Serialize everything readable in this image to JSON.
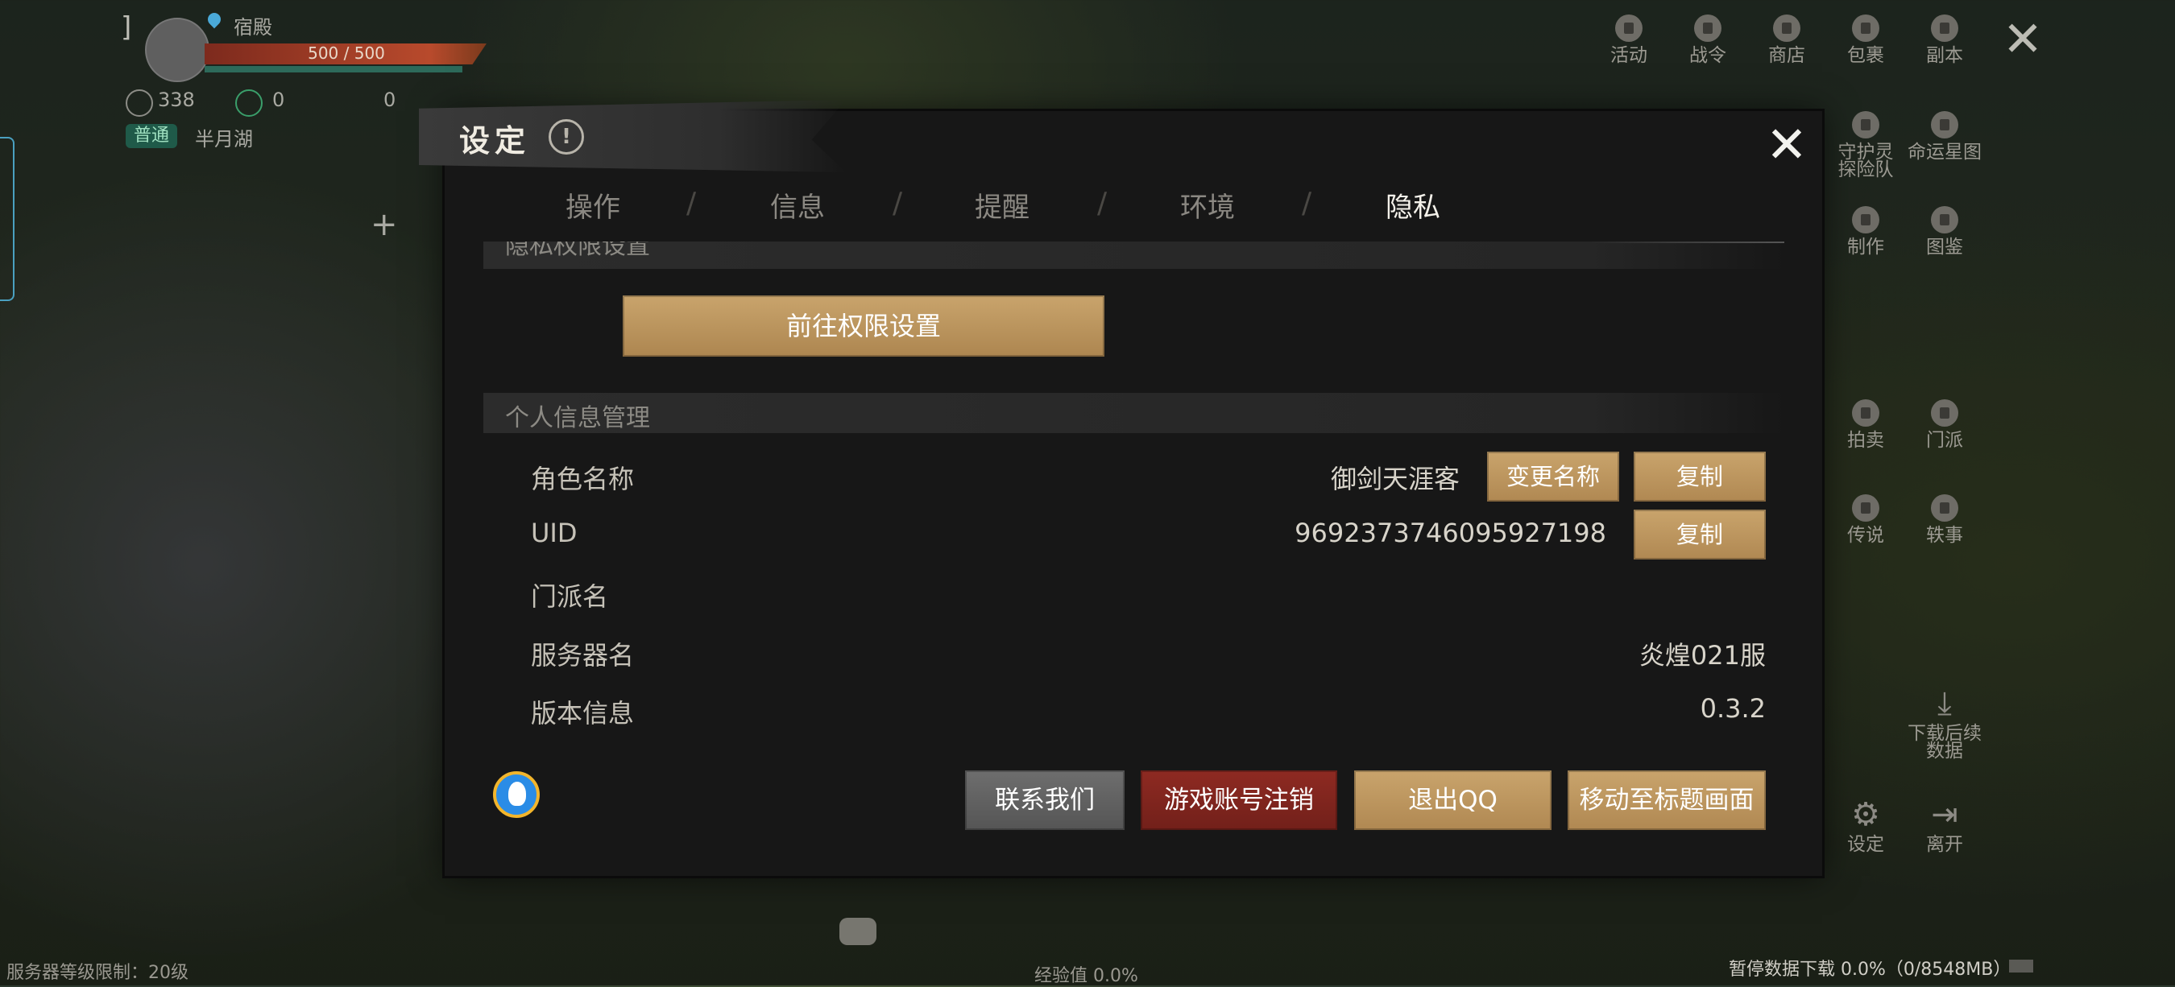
{
  "hud": {
    "location": "宿殿",
    "hp": "500 / 500",
    "currency1": "338",
    "currency2": "0",
    "currency3": "0",
    "status_badge": "普通",
    "area": "半月湖",
    "server_level_note": "服务器等级限制：20级",
    "exp_text": "经验值 0.0%",
    "download_status": "暂停数据下载 0.0%（0/8548MB）"
  },
  "right_menu": {
    "items": [
      {
        "label": "活动",
        "icon": "lock-icon"
      },
      {
        "label": "战令",
        "icon": "lock-icon"
      },
      {
        "label": "商店",
        "icon": "lock-icon"
      },
      {
        "label": "包裹",
        "icon": "lock-icon"
      },
      {
        "label": "副本",
        "icon": "lock-icon"
      },
      {
        "label": "守护灵\n探险队",
        "icon": "lock-icon"
      },
      {
        "label": "命运星图",
        "icon": "lock-icon"
      },
      {
        "label": "制作",
        "icon": "lock-icon"
      },
      {
        "label": "图鉴",
        "icon": "lock-icon"
      },
      {
        "label": "拍卖",
        "icon": "lock-icon"
      },
      {
        "label": "门派",
        "icon": "lock-icon"
      },
      {
        "label": "传说",
        "icon": "lock-icon"
      },
      {
        "label": "轶事",
        "icon": "lock-icon"
      },
      {
        "label": "下载后续\n数据",
        "icon": "download-icon"
      },
      {
        "label": "设定",
        "icon": "gear-icon"
      },
      {
        "label": "离开",
        "icon": "exit-icon"
      }
    ]
  },
  "dialog": {
    "title": "设定",
    "tabs": [
      "操作",
      "信息",
      "提醒",
      "环境",
      "隐私"
    ],
    "active_tab": "隐私",
    "privacy_section_title": "隐私权限设置",
    "permission_button": "前往权限设置",
    "personal_section_title": "个人信息管理",
    "rows": {
      "role_name_label": "角色名称",
      "role_name_value": "御剑天涯客",
      "change_name_button": "变更名称",
      "copy_button": "复制",
      "uid_label": "UID",
      "uid_value": "9692373746095927198",
      "uid_copy_button": "复制",
      "sect_label": "门派名",
      "sect_value": "",
      "server_label": "服务器名",
      "server_value": "炎煌021服",
      "version_label": "版本信息",
      "version_value": "0.3.2"
    },
    "footer_buttons": {
      "contact": "联系我们",
      "cancel_account": "游戏账号注销",
      "logout_qq": "退出QQ",
      "to_title": "移动至标题画面"
    }
  }
}
